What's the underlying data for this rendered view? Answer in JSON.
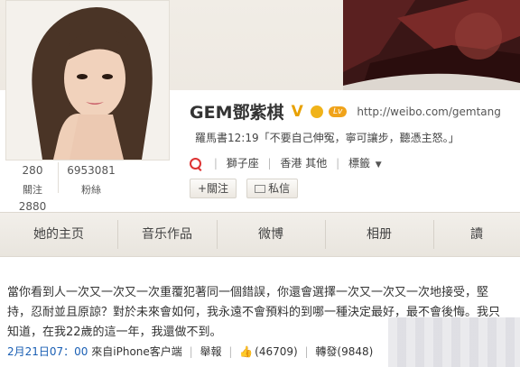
{
  "profile": {
    "name": "GEM鄧紫棋",
    "verified_mark": "V",
    "vip_label": "Lv",
    "url": "http://weibo.com/gemtang",
    "status_time": "羅馬書12:19",
    "status_text": "「不要自己伸冤，寧可讓步，聽憑主怒。」",
    "tags": [
      "獅子座",
      "香港 其他",
      "標籤"
    ],
    "follow_button": "+關注",
    "message_button": "私信"
  },
  "stats": [
    {
      "value": "280",
      "label": "關注"
    },
    {
      "value": "6953081",
      "label": "粉絲"
    },
    {
      "value": "2880",
      "label": ""
    }
  ],
  "tabs": [
    "她的主页",
    "音乐作品",
    "微博",
    "相册",
    "讀"
  ],
  "post": {
    "text": "當你看到人一次又一次又一次重覆犯著同一個錯誤，你還會選擇一次又一次又一次地接受，堅持，忍耐並且原諒？對於未來會如何，我永遠不會預料的到哪一種決定最好，最不會後悔。我只知道，在我22歲的這一年，我還做不到。",
    "date": "2月21日07：00",
    "source": "來自iPhone客户端",
    "report": "舉報",
    "likes": "(46709)",
    "repost": "轉發(9848)"
  },
  "colors": {
    "accent_orange": "#f08300",
    "link_blue": "#1a5fb4",
    "tab_bg": "#ece8e1"
  }
}
